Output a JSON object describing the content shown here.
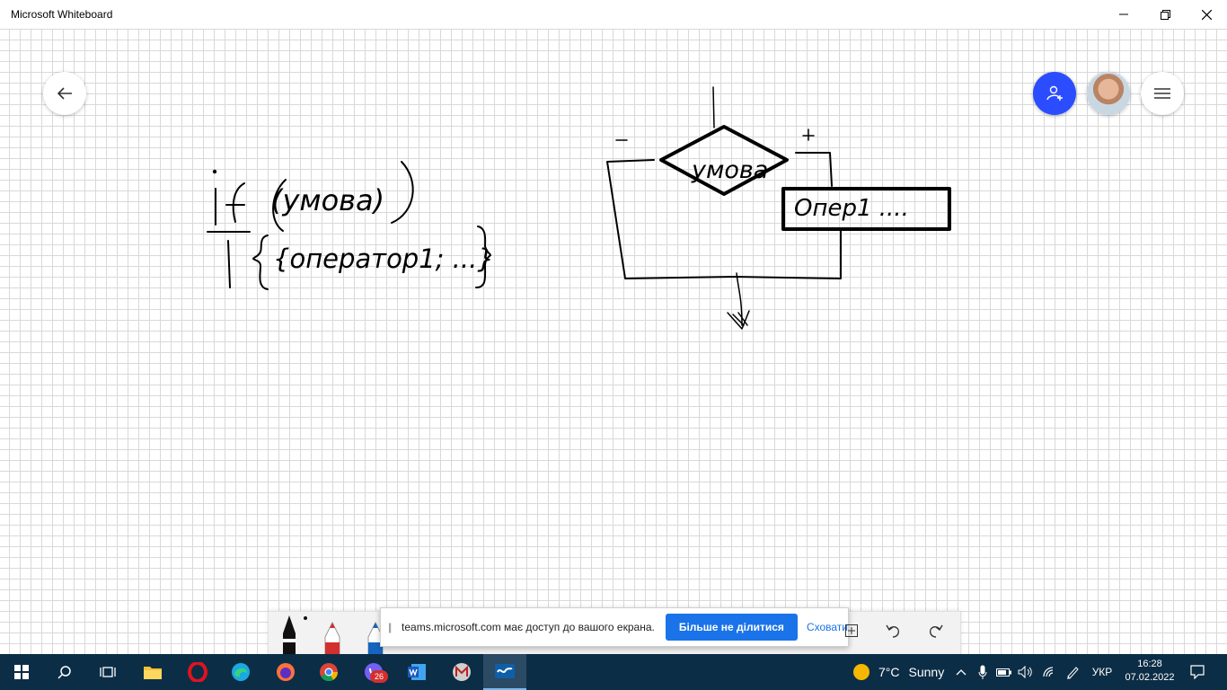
{
  "window": {
    "title": "Microsoft Whiteboard"
  },
  "canvas": {
    "ink_left": {
      "keyword": "if",
      "condition": "(умова)",
      "body": "{оператор1; ...}"
    },
    "ink_flowchart": {
      "diamond": "умова",
      "minus": "-",
      "plus": "+",
      "box": "Опер1 ...."
    }
  },
  "icons": {
    "back": "arrow-left-icon",
    "invite": "add-person-icon",
    "menu": "hamburger-icon"
  },
  "share_banner": {
    "grip": "||",
    "message": "teams.microsoft.com має доступ до вашого екрана.",
    "stop_label": "Більше не ділитися",
    "hide_label": "Сховати"
  },
  "taskbar": {
    "viber_badge": "26",
    "weather": {
      "temp": "7°C",
      "condition": "Sunny"
    },
    "language": "УКР",
    "time": "16:28",
    "date": "07.02.2022"
  },
  "colors": {
    "invite_blue": "#2b4dff",
    "taskbar_bg": "#0c2d46",
    "share_blue": "#1a73e8"
  }
}
